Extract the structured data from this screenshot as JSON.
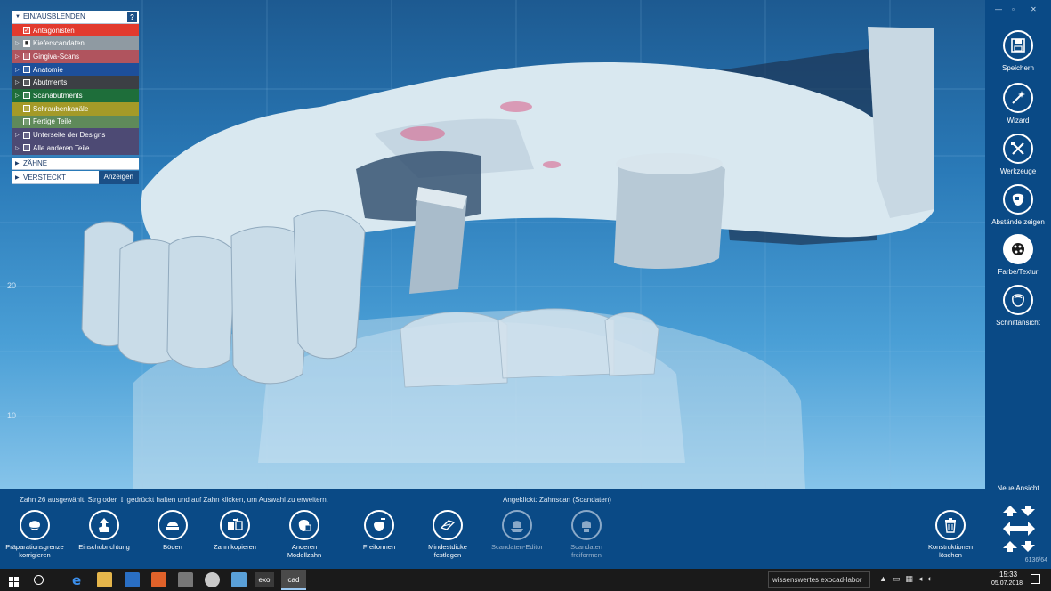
{
  "tree": {
    "header_label": "EIN/AUSBLENDEN",
    "help_label": "?",
    "items": [
      {
        "label": "Antagonisten",
        "color": "#e23a2e",
        "checked": true,
        "expand": false
      },
      {
        "label": "Kieferscandaten",
        "color": "#8f9aa2",
        "checked": true,
        "expand": true
      },
      {
        "label": "Gingiva-Scans",
        "color": "#b0545e",
        "checked": false,
        "expand": true
      },
      {
        "label": "Anatomie",
        "color": "#1d4f9a",
        "checked": false,
        "expand": true
      },
      {
        "label": "Abutments",
        "color": "#3c3f44",
        "checked": false,
        "expand": true
      },
      {
        "label": "Scanabutments",
        "color": "#1e6e3a",
        "checked": false,
        "expand": true
      },
      {
        "label": "Schraubenkanäle",
        "color": "#a49a28",
        "checked": false,
        "expand": false
      },
      {
        "label": "Fertige Teile",
        "color": "#5f8a5a",
        "checked": false,
        "expand": false
      },
      {
        "label": "Unterseite der Designs",
        "color": "#4d4a74",
        "checked": false,
        "expand": true
      },
      {
        "label": "Alle anderen Teile",
        "color": "#4d4a74",
        "checked": false,
        "expand": true
      }
    ],
    "zaehne_label": "ZÄHNE",
    "versteckt_label": "VERSTECKT",
    "anzeigen_label": "Anzeigen"
  },
  "ruler": {
    "mark_upper": "20",
    "mark_lower": "10"
  },
  "window_controls": {
    "min": "—",
    "max": "▫",
    "close": "✕"
  },
  "sidebar": {
    "buttons": [
      {
        "label": "Speichern",
        "icon": "floppy-disk-icon"
      },
      {
        "label": "Wizard",
        "icon": "magic-wand-icon"
      },
      {
        "label": "Werkzeuge",
        "icon": "tools-icon"
      },
      {
        "label": "Abstände zeigen",
        "icon": "distance-icon"
      },
      {
        "label": "Farbe/Textur",
        "icon": "color-texture-icon"
      },
      {
        "label": "Schnittansicht",
        "icon": "cross-section-icon"
      }
    ],
    "neue_ansicht_label": "Neue Ansicht",
    "dims": "6136/64"
  },
  "status": {
    "message": "Zahn 26 ausgewählt. Strg oder ⇧ gedrückt halten und auf Zahn klicken, um Auswahl zu erweitern.",
    "clicked_label": "Angeklickt:",
    "clicked_value": "Zahnscan (Scandaten)"
  },
  "tools": [
    {
      "label": "Präparationsgrenze\nkorrigieren",
      "icon": "margin-line-icon",
      "dim": false
    },
    {
      "label": "Einschubrichtung",
      "icon": "insertion-direction-icon",
      "dim": false
    },
    {
      "label": "Böden",
      "icon": "bottom-icon",
      "dim": false
    },
    {
      "label": "Zahn kopieren",
      "icon": "copy-tooth-icon",
      "dim": false
    },
    {
      "label": "Anderen\nModellzahn",
      "icon": "model-tooth-icon",
      "dim": false
    },
    {
      "label": "Freiformen",
      "icon": "freeform-icon",
      "dim": false
    },
    {
      "label": "Mindestdicke\nfestlegen",
      "icon": "min-thickness-icon",
      "dim": false
    },
    {
      "label": "Scandaten-Editor",
      "icon": "scan-editor-icon",
      "dim": true
    },
    {
      "label": "Scandaten\nfreiformen",
      "icon": "scan-freeform-icon",
      "dim": true
    }
  ],
  "delete_tool": {
    "label": "Konstruktionen\nlöschen",
    "icon": "trash-icon"
  },
  "taskbar": {
    "app_exo": "exo",
    "app_cad": "cad",
    "search_text": "wissenswertes exocad-labor",
    "time": "15:33",
    "date": "05.07.2018"
  }
}
